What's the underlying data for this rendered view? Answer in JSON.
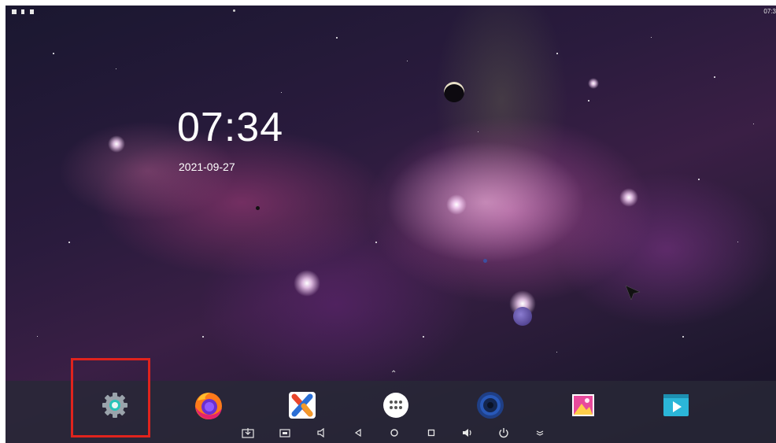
{
  "status_bar": {
    "time": "07:3",
    "icons": [
      "screenshot-icon",
      "usb-icon",
      "sd-card-icon"
    ]
  },
  "clock": {
    "time": "07:34",
    "date": "2021-09-27"
  },
  "dock": {
    "apps": [
      {
        "name": "settings-app",
        "icon": "gear-icon",
        "highlighted": true
      },
      {
        "name": "firefox-app",
        "icon": "firefox-icon"
      },
      {
        "name": "x-app",
        "icon": "x-logo-icon"
      },
      {
        "name": "app-drawer",
        "icon": "grid-dots-icon"
      },
      {
        "name": "music-app",
        "icon": "speaker-icon"
      },
      {
        "name": "gallery-app",
        "icon": "gallery-icon"
      },
      {
        "name": "video-app",
        "icon": "play-icon"
      }
    ],
    "highlight_color": "#e0231d"
  },
  "nav_bar": {
    "icons": [
      "download-icon",
      "screenshot-icon",
      "volume-down-icon",
      "back-icon",
      "home-icon",
      "recents-icon",
      "volume-up-icon",
      "power-icon",
      "menu-expand-icon"
    ]
  }
}
